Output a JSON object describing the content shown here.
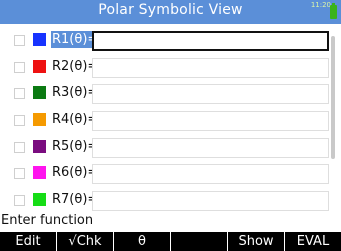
{
  "header": {
    "title": "Polar Symbolic View",
    "clock": "11:20",
    "accent": "#5b8fd8"
  },
  "functions": [
    {
      "label": "R1(θ)=",
      "color": "#1733ff",
      "value": "",
      "checked": false,
      "selected": true
    },
    {
      "label": "R2(θ)=",
      "color": "#ee1111",
      "value": "",
      "checked": false,
      "selected": false
    },
    {
      "label": "R3(θ)=",
      "color": "#0b7a12",
      "value": "",
      "checked": false,
      "selected": false
    },
    {
      "label": "R4(θ)=",
      "color": "#f59a00",
      "value": "",
      "checked": false,
      "selected": false
    },
    {
      "label": "R5(θ)=",
      "color": "#7a0c7f",
      "value": "",
      "checked": false,
      "selected": false
    },
    {
      "label": "R6(θ)=",
      "color": "#ff14ee",
      "value": "",
      "checked": false,
      "selected": false
    },
    {
      "label": "R7(θ)=",
      "color": "#16dd16",
      "value": "",
      "checked": false,
      "selected": false
    }
  ],
  "status": {
    "prompt": "Enter function"
  },
  "menu": {
    "edit": "Edit",
    "check": "√Chk",
    "theta": "θ",
    "blank1": "",
    "show": "Show",
    "eval": "EVAL"
  }
}
